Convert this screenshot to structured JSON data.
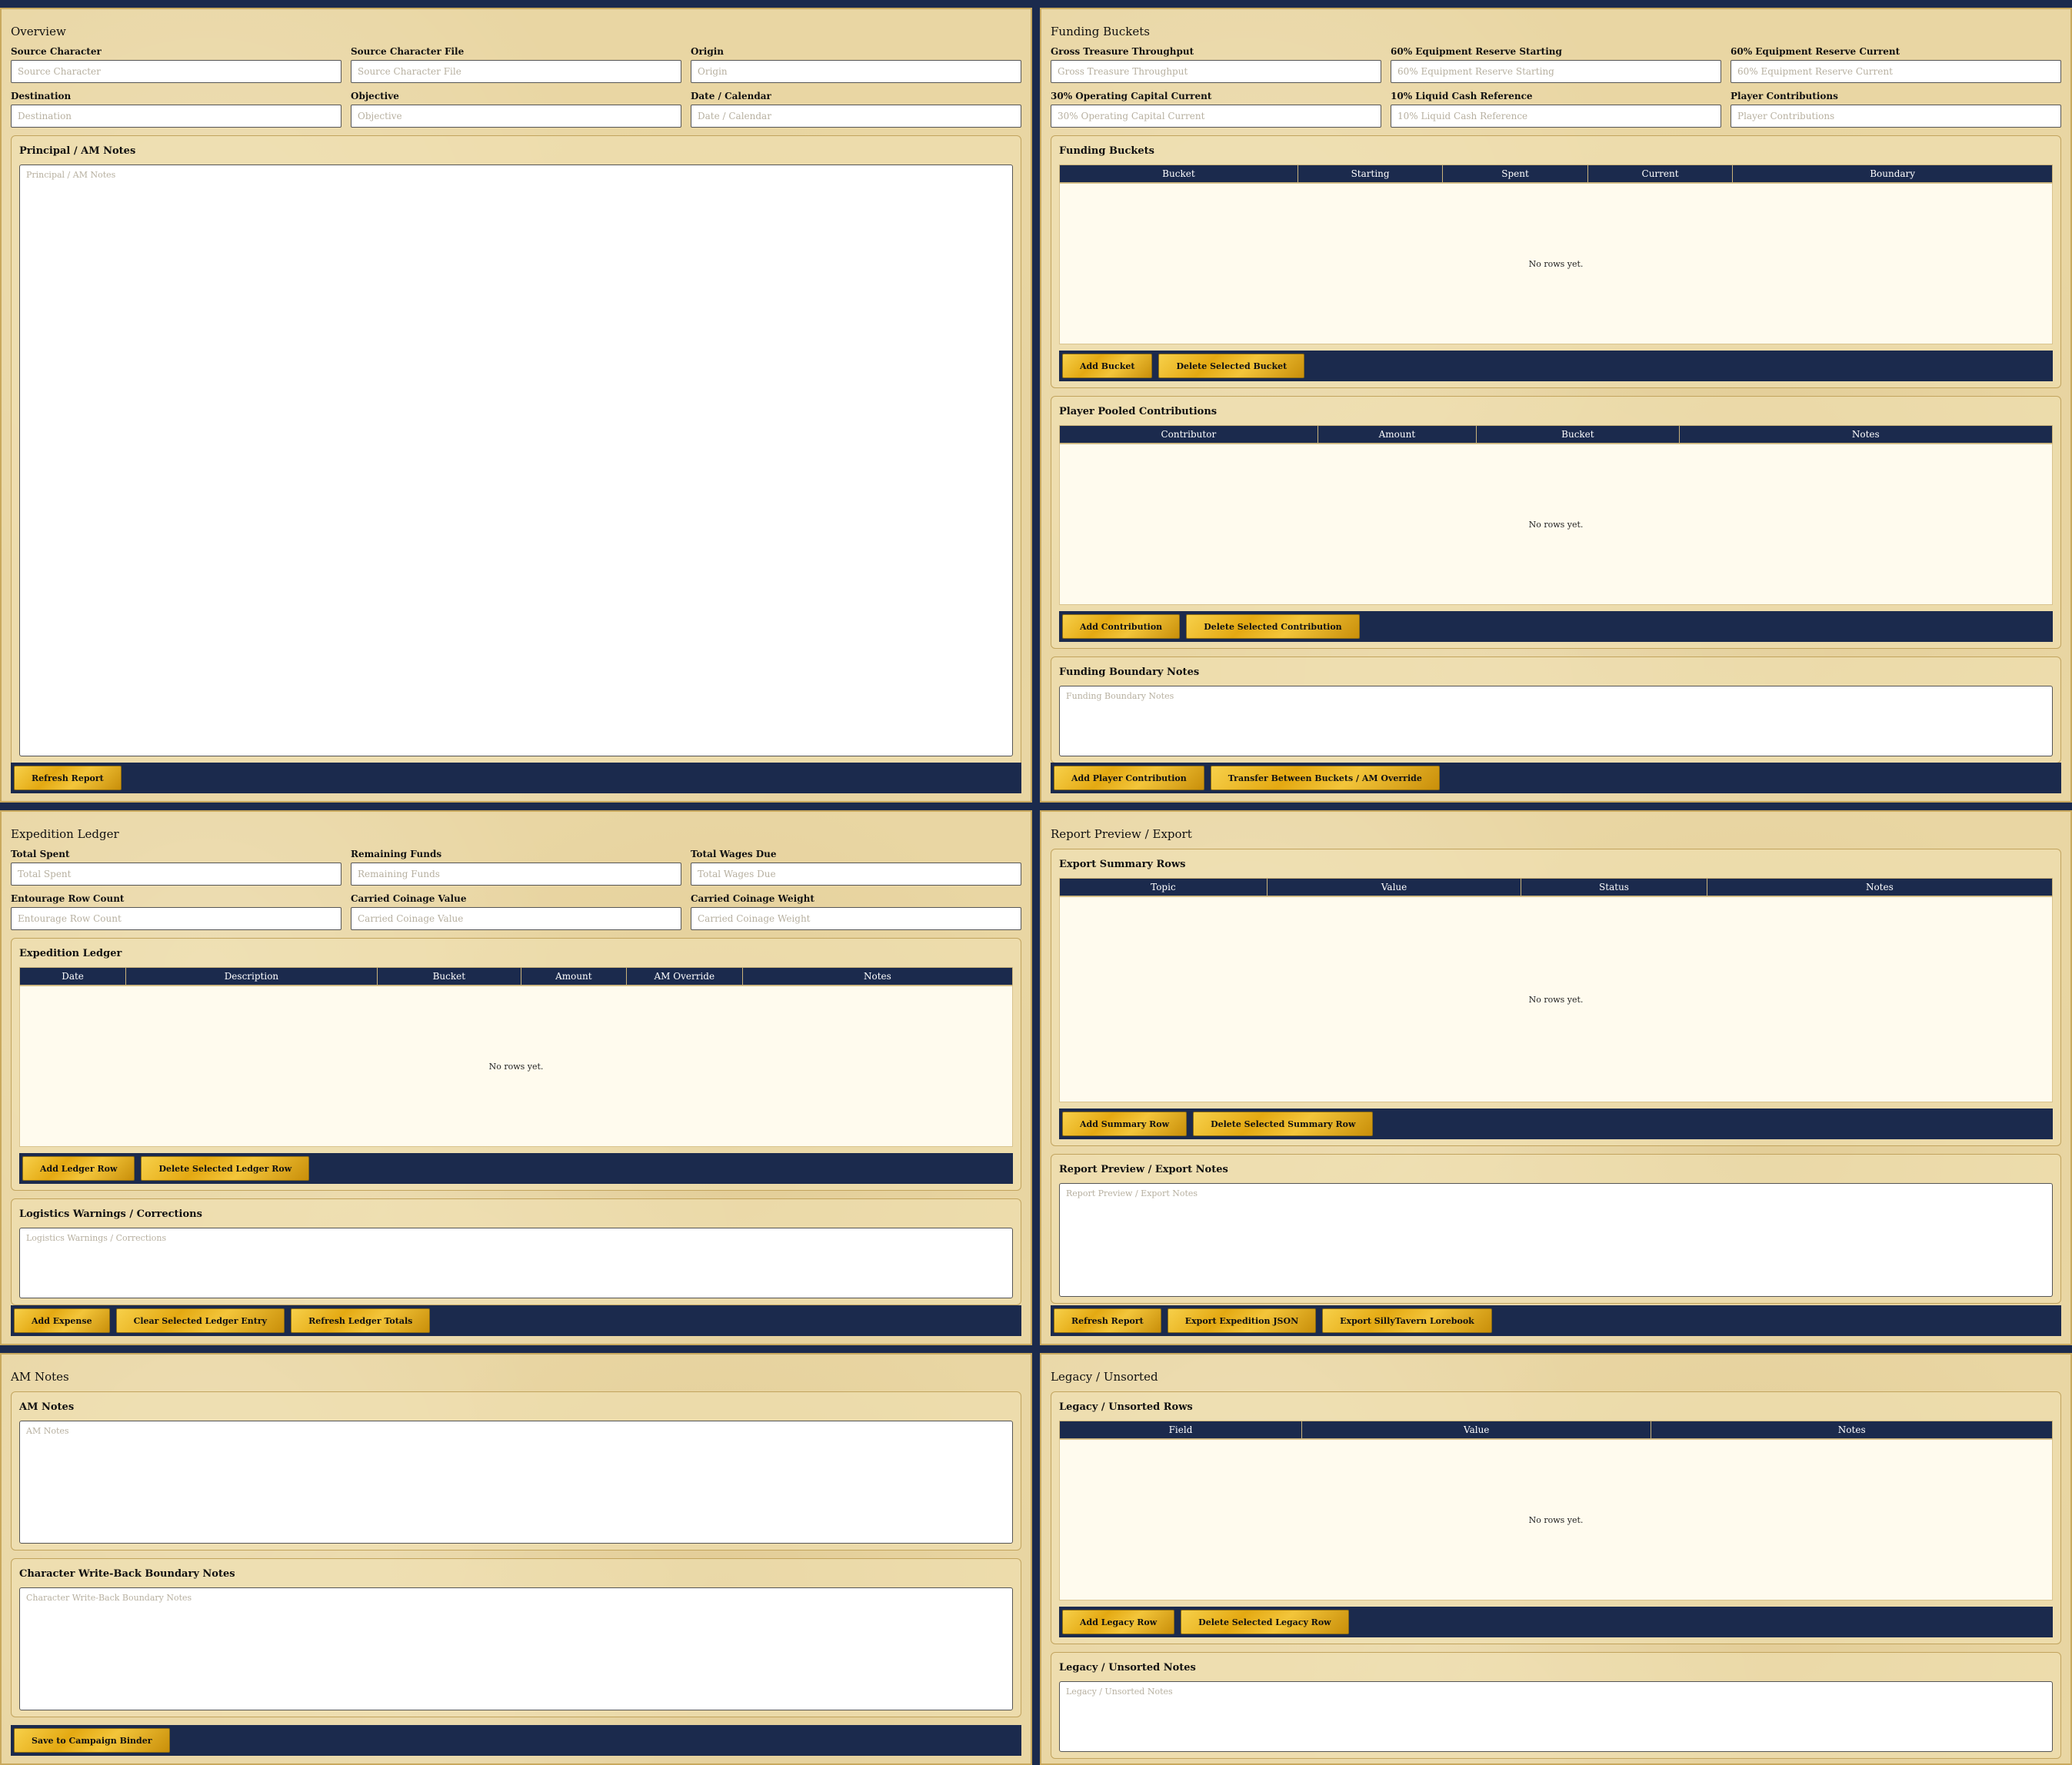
{
  "overview": {
    "title": "Overview",
    "fields": [
      {
        "label": "Source Character",
        "placeholder": "Source Character"
      },
      {
        "label": "Source Character File",
        "placeholder": "Source Character File"
      },
      {
        "label": "Origin",
        "placeholder": "Origin"
      },
      {
        "label": "Destination",
        "placeholder": "Destination"
      },
      {
        "label": "Objective",
        "placeholder": "Objective"
      },
      {
        "label": "Date / Calendar",
        "placeholder": "Date / Calendar"
      }
    ],
    "notes_title": "Principal / AM Notes",
    "notes_placeholder": "Principal / AM Notes",
    "buttons": [
      "Refresh Report"
    ]
  },
  "funding": {
    "title": "Funding Buckets",
    "fields": [
      {
        "label": "Gross Treasure Throughput",
        "placeholder": "Gross Treasure Throughput"
      },
      {
        "label": "60% Equipment Reserve Starting",
        "placeholder": "60% Equipment Reserve Starting"
      },
      {
        "label": "60% Equipment Reserve Current",
        "placeholder": "60% Equipment Reserve Current"
      },
      {
        "label": "30% Operating Capital Current",
        "placeholder": "30% Operating Capital Current"
      },
      {
        "label": "10% Liquid Cash Reference",
        "placeholder": "10% Liquid Cash Reference"
      },
      {
        "label": "Player Contributions",
        "placeholder": "Player Contributions"
      }
    ],
    "buckets_title": "Funding Buckets",
    "buckets_columns": [
      "Bucket",
      "Starting",
      "Spent",
      "Current",
      "Boundary"
    ],
    "buckets_empty": "No rows yet.",
    "buckets_buttons": [
      "Add Bucket",
      "Delete Selected Bucket"
    ],
    "pooled_title": "Player Pooled Contributions",
    "pooled_columns": [
      "Contributor",
      "Amount",
      "Bucket",
      "Notes"
    ],
    "pooled_empty": "No rows yet.",
    "pooled_buttons": [
      "Add Contribution",
      "Delete Selected Contribution"
    ],
    "boundary_title": "Funding Boundary Notes",
    "boundary_placeholder": "Funding Boundary Notes",
    "buttons": [
      "Add Player Contribution",
      "Transfer Between Buckets / AM Override"
    ]
  },
  "ledger": {
    "title": "Expedition Ledger",
    "fields": [
      {
        "label": "Total Spent",
        "placeholder": "Total Spent"
      },
      {
        "label": "Remaining Funds",
        "placeholder": "Remaining Funds"
      },
      {
        "label": "Total Wages Due",
        "placeholder": "Total Wages Due"
      },
      {
        "label": "Entourage Row Count",
        "placeholder": "Entourage Row Count"
      },
      {
        "label": "Carried Coinage Value",
        "placeholder": "Carried Coinage Value"
      },
      {
        "label": "Carried Coinage Weight",
        "placeholder": "Carried Coinage Weight"
      }
    ],
    "table_title": "Expedition Ledger",
    "table_columns": [
      "Date",
      "Description",
      "Bucket",
      "Amount",
      "AM Override",
      "Notes"
    ],
    "table_empty": "No rows yet.",
    "table_buttons": [
      "Add Ledger Row",
      "Delete Selected Ledger Row"
    ],
    "warnings_title": "Logistics Warnings / Corrections",
    "warnings_placeholder": "Logistics Warnings / Corrections",
    "buttons": [
      "Add Expense",
      "Clear Selected Ledger Entry",
      "Refresh Ledger Totals"
    ]
  },
  "report": {
    "title": "Report Preview / Export",
    "summary_title": "Export Summary Rows",
    "summary_columns": [
      "Topic",
      "Value",
      "Status",
      "Notes"
    ],
    "summary_empty": "No rows yet.",
    "summary_buttons": [
      "Add Summary Row",
      "Delete Selected Summary Row"
    ],
    "notes_title": "Report Preview / Export Notes",
    "notes_placeholder": "Report Preview / Export Notes",
    "buttons": [
      "Refresh Report",
      "Export Expedition JSON",
      "Export SillyTavern Lorebook"
    ]
  },
  "am_notes": {
    "title": "AM Notes",
    "notes_title": "AM Notes",
    "notes_placeholder": "AM Notes",
    "writeback_title": "Character Write-Back Boundary Notes",
    "writeback_placeholder": "Character Write-Back Boundary Notes",
    "buttons": [
      "Save to Campaign Binder"
    ]
  },
  "legacy": {
    "title": "Legacy / Unsorted",
    "rows_title": "Legacy / Unsorted Rows",
    "rows_columns": [
      "Field",
      "Value",
      "Notes"
    ],
    "rows_empty": "No rows yet.",
    "rows_buttons": [
      "Add Legacy Row",
      "Delete Selected Legacy Row"
    ],
    "notes_title": "Legacy / Unsorted Notes",
    "notes_placeholder": "Legacy / Unsorted Notes"
  }
}
